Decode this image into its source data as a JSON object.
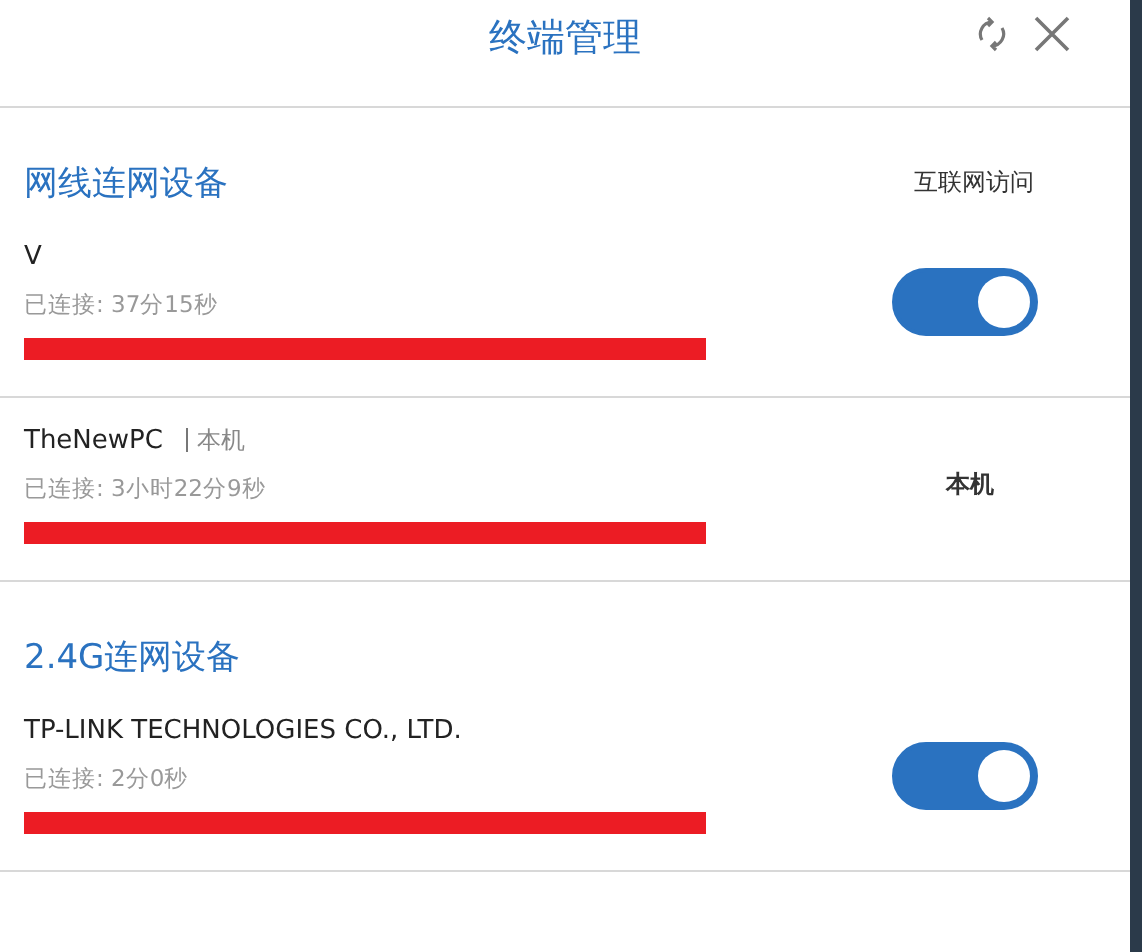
{
  "window": {
    "title": "终端管理"
  },
  "sections": [
    {
      "title": "网线连网设备",
      "column_header": "互联网访问",
      "devices": [
        {
          "name": "V",
          "connected": "已连接: 37分15秒",
          "access": {
            "kind": "toggle",
            "on": true
          }
        },
        {
          "name": "TheNewPC",
          "tag": "本机",
          "connected": "已连接: 3小时22分9秒",
          "access": {
            "kind": "label",
            "text": "本机"
          }
        }
      ]
    },
    {
      "title": "2.4G连网设备",
      "devices": [
        {
          "name": "TP-LINK TECHNOLOGIES CO., LTD.",
          "connected": "已连接: 2分0秒",
          "access": {
            "kind": "toggle",
            "on": true
          }
        }
      ]
    }
  ]
}
